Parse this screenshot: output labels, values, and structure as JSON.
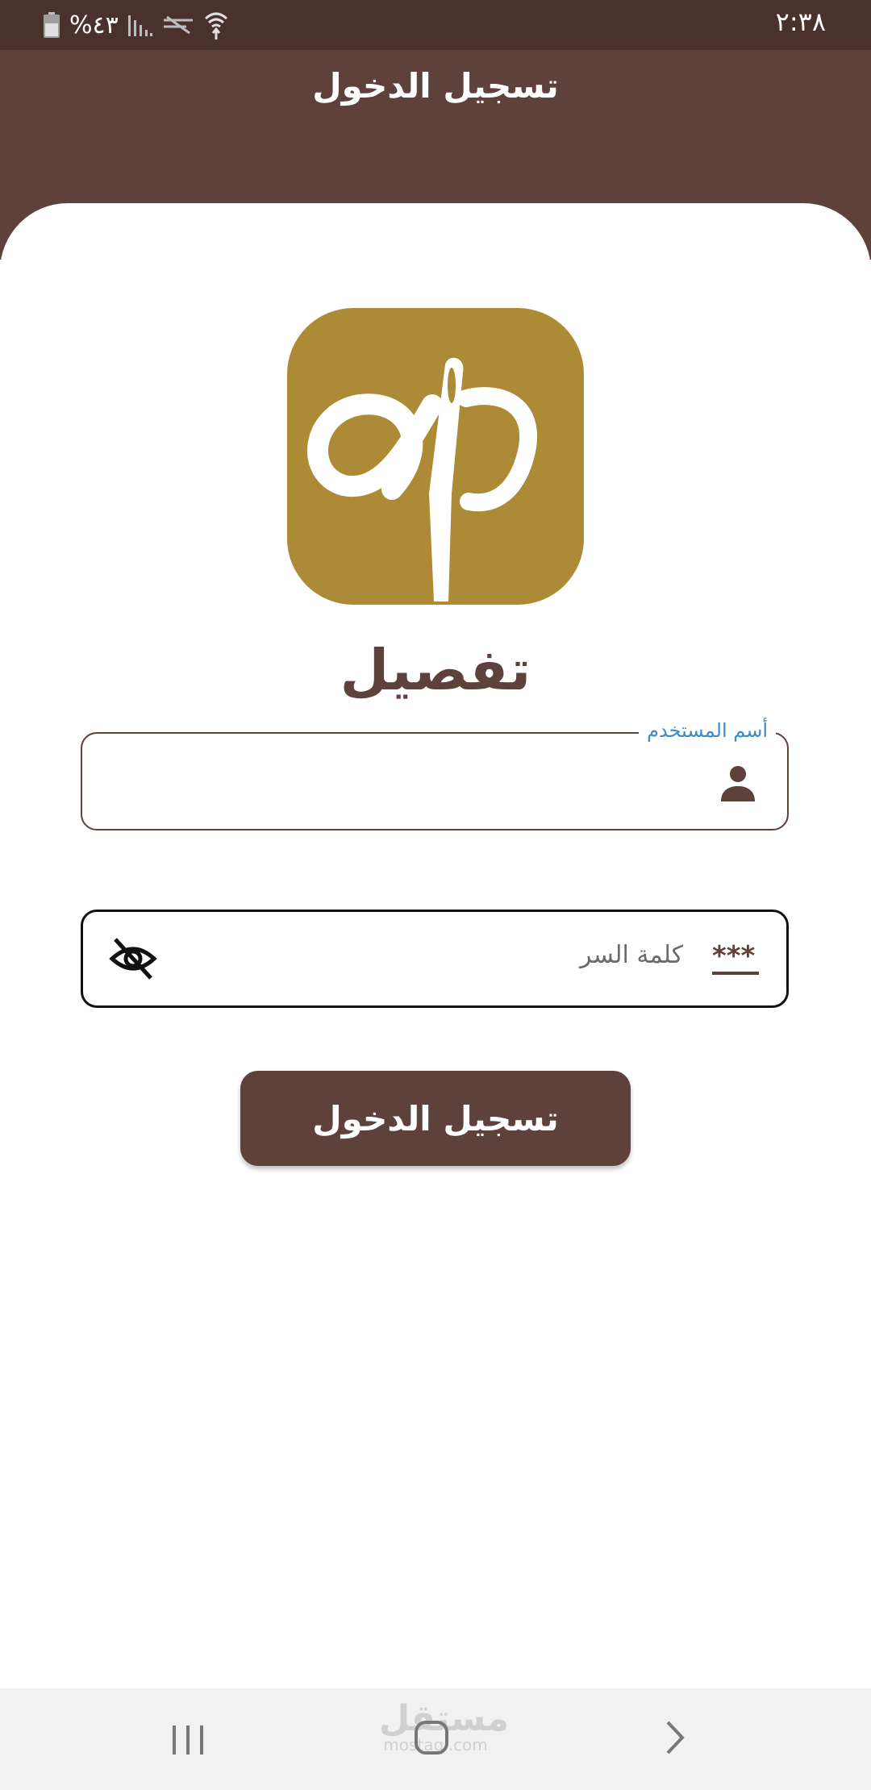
{
  "status_bar": {
    "time": "٢:٣٨",
    "battery_percent": "%٤٣",
    "icons": [
      "battery-icon",
      "signal-icon",
      "no-signal-icon",
      "wifi-icon"
    ]
  },
  "app_bar": {
    "title": "تسجيل الدخول"
  },
  "brand": {
    "name": "تفصيل",
    "logo_icon": "needle-thread-logo",
    "logo_color": "#ac8a36"
  },
  "form": {
    "username": {
      "label": "أسم المستخدم",
      "value": "",
      "icon": "person-icon"
    },
    "password": {
      "placeholder": "كلمة السر",
      "value": "",
      "leading_icon": "password-stars-icon",
      "toggle_icon": "eye-off-icon"
    },
    "submit_label": "تسجيل الدخول"
  },
  "nav_bar": {
    "watermark_ar": "مستقل",
    "watermark_en": "mostaql.com"
  },
  "colors": {
    "primary": "#5d413a",
    "status_bar": "#4b312b",
    "label_accent": "#3a8dc0"
  }
}
